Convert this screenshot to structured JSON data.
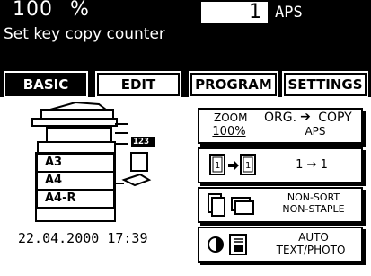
{
  "status": {
    "zoom_value": "100",
    "zoom_unit": "%",
    "copy_count": "1",
    "paper_mode": "APS",
    "message": "Set key copy counter"
  },
  "tabs": [
    {
      "label": "BASIC",
      "active": true
    },
    {
      "label": "EDIT",
      "active": false
    },
    {
      "label": "PROGRAM",
      "active": false
    },
    {
      "label": "SETTINGS",
      "active": false
    }
  ],
  "machine": {
    "counter_label": "123",
    "trays": [
      "A3",
      "A4",
      "A4-R"
    ]
  },
  "datetime": "22.04.2000 17:39",
  "buttons": {
    "zoom": {
      "label1": "ZOOM",
      "value": "100%",
      "label2": "ORG.",
      "label3": "COPY",
      "mode": "APS"
    },
    "duplex": {
      "text": "1 → 1"
    },
    "sort": {
      "line1": "NON-SORT",
      "line2": "NON-STAPLE"
    },
    "image": {
      "line1": "AUTO",
      "line2": "TEXT/PHOTO"
    }
  },
  "colors": {
    "background": "#ffffff",
    "foreground": "#000000"
  }
}
